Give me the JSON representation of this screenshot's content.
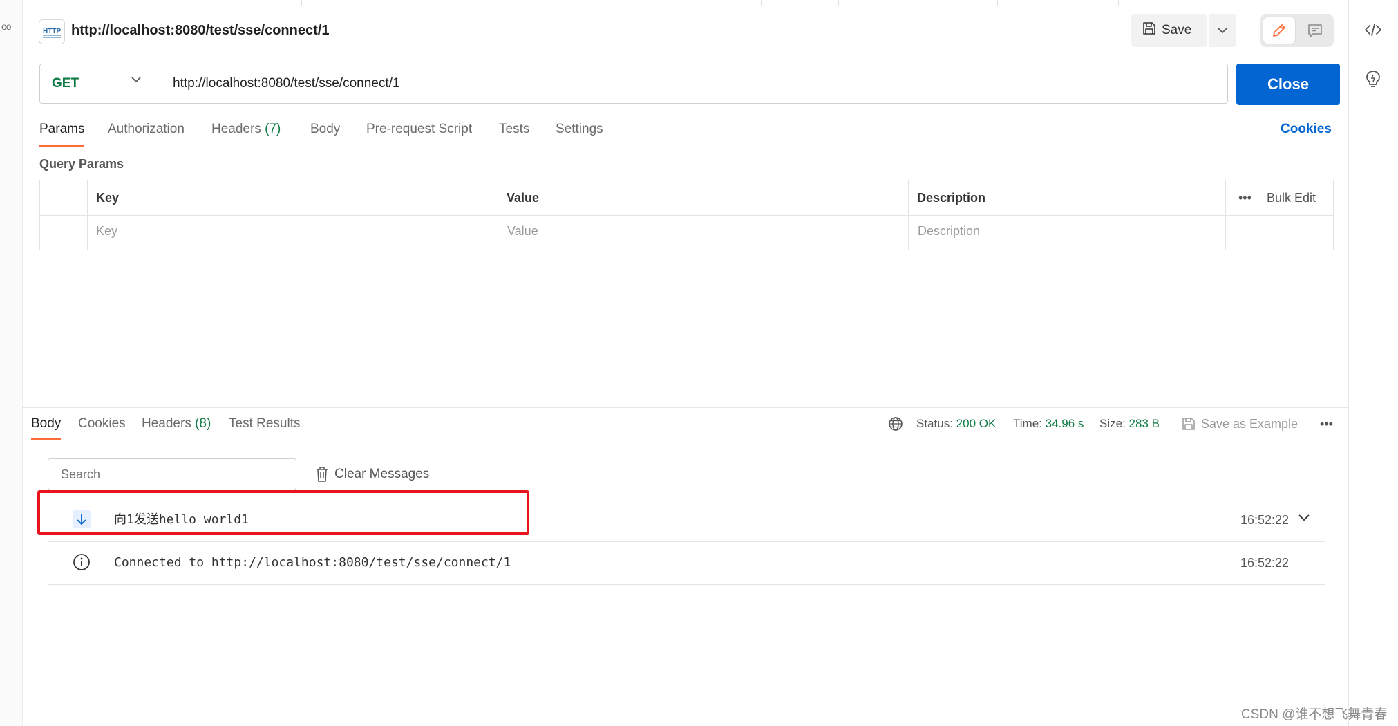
{
  "window": {
    "left_menu_dots": "oo"
  },
  "request": {
    "title": "http://localhost:8080/test/sse/connect/1",
    "http_badge": "HTTP",
    "save_label": "Save",
    "method": "GET",
    "url": "http://localhost:8080/test/sse/connect/1",
    "action_label": "Close",
    "cookies_link": "Cookies",
    "tabs": [
      {
        "label": "Params",
        "count": ""
      },
      {
        "label": "Authorization",
        "count": ""
      },
      {
        "label": "Headers",
        "count": "(7)"
      },
      {
        "label": "Body",
        "count": ""
      },
      {
        "label": "Pre-request Script",
        "count": ""
      },
      {
        "label": "Tests",
        "count": ""
      },
      {
        "label": "Settings",
        "count": ""
      }
    ],
    "active_tab": "Params"
  },
  "query_params": {
    "label": "Query Params",
    "columns": [
      "Key",
      "Value",
      "Description"
    ],
    "placeholders": [
      "Key",
      "Value",
      "Description"
    ],
    "more": "•••",
    "bulk_edit": "Bulk Edit"
  },
  "response": {
    "tabs": [
      {
        "label": "Body",
        "count": ""
      },
      {
        "label": "Cookies",
        "count": ""
      },
      {
        "label": "Headers",
        "count": "(8)"
      },
      {
        "label": "Test Results",
        "count": ""
      }
    ],
    "active_tab": "Body",
    "status_label": "Status:",
    "status_value": "200 OK",
    "time_label": "Time:",
    "time_value": "34.96 s",
    "size_label": "Size:",
    "size_value": "283 B",
    "save_example": "Save as Example",
    "more": "•••",
    "search_placeholder": "Search",
    "clear_messages": "Clear Messages",
    "messages": [
      {
        "icon": "arrow-down-icon",
        "text": "向1发送hello world1",
        "time": "16:52:22",
        "expandable": true
      },
      {
        "icon": "info-icon",
        "text": "Connected to http://localhost:8080/test/sse/connect/1",
        "time": "16:52:22",
        "expandable": false
      }
    ]
  },
  "watermark": "CSDN @谁不想飞舞青春",
  "colors": {
    "accent": "#ff6c37",
    "primary_button": "#0265d2",
    "success": "#0c7a43",
    "highlight_box": "#e8141b"
  }
}
